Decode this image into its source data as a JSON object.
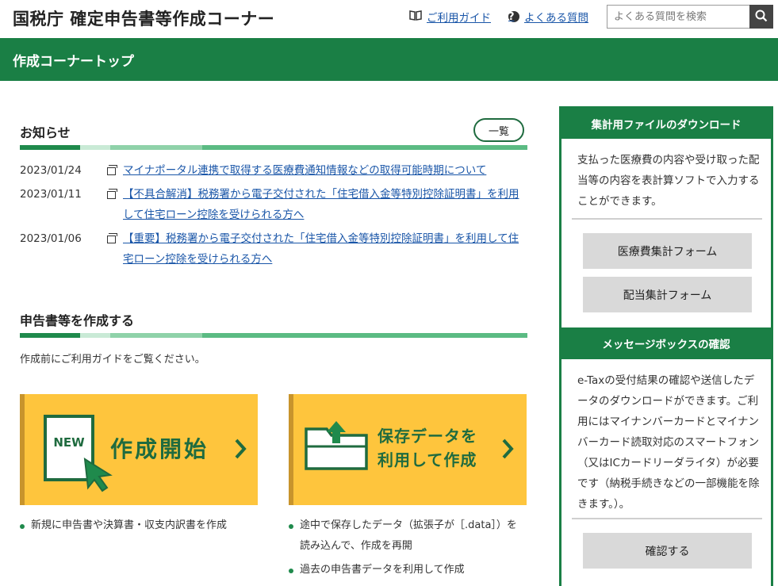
{
  "header": {
    "site_title": "国税庁 確定申告書等作成コーナー",
    "guide_link": "ご利用ガイド",
    "faq_link": "よくある質問",
    "search_placeholder": "よくある質問を検索"
  },
  "band": {
    "title": "作成コーナートップ"
  },
  "notices": {
    "heading": "お知らせ",
    "list_button": "一覧",
    "items": [
      {
        "date": "2023/01/24",
        "text": "マイナポータル連携で取得する医療費通知情報などの取得可能時期について"
      },
      {
        "date": "2023/01/11",
        "text": "【不具合解消】税務署から電子交付された「住宅借入金等特別控除証明書」を利用して住宅ローン控除を受けられる方へ"
      },
      {
        "date": "2023/01/06",
        "text": "【重要】税務署から電子交付された「住宅借入金等特別控除証明書」を利用して住宅ローン控除を受けられる方へ"
      }
    ]
  },
  "create": {
    "heading": "申告書等を作成する",
    "description": "作成前にご利用ガイドをご覧ください。",
    "cards": [
      {
        "label": "作成開始",
        "badge": "NEW",
        "bullets": [
          "新規に申告書や決算書・収支内訳書を作成"
        ]
      },
      {
        "label_line1": "保存データを",
        "label_line2": "利用して作成",
        "bullets": [
          "途中で保存したデータ（拡張子が［.data］）を読み込んで、作成を再開",
          "過去の申告書データを利用して作成"
        ]
      }
    ]
  },
  "sidebar": {
    "download": {
      "heading": "集計用ファイルのダウンロード",
      "text": "支払った医療費の内容や受け取った配当等の内容を表計算ソフトで入力することができます。",
      "buttons": [
        "医療費集計フォーム",
        "配当集計フォーム"
      ]
    },
    "messagebox": {
      "heading": "メッセージボックスの確認",
      "text": "e-Taxの受付結果の確認や送信したデータのダウンロードができます。ご利用にはマイナンバーカードとマイナンバーカード読取対応のスマートフォン（又はICカードリーダライタ）が必要です（納税手続きなどの一部機能を除きます。）。",
      "button": "確認する"
    }
  },
  "colors": {
    "brand_green": "#1a7f45",
    "card_yellow": "#fec53d",
    "link_blue": "#1a56a8"
  },
  "icons": [
    "book-icon",
    "question-icon",
    "search-icon",
    "document-icon",
    "new-document-icon",
    "folder-upload-icon",
    "chevron-right-icon"
  ]
}
